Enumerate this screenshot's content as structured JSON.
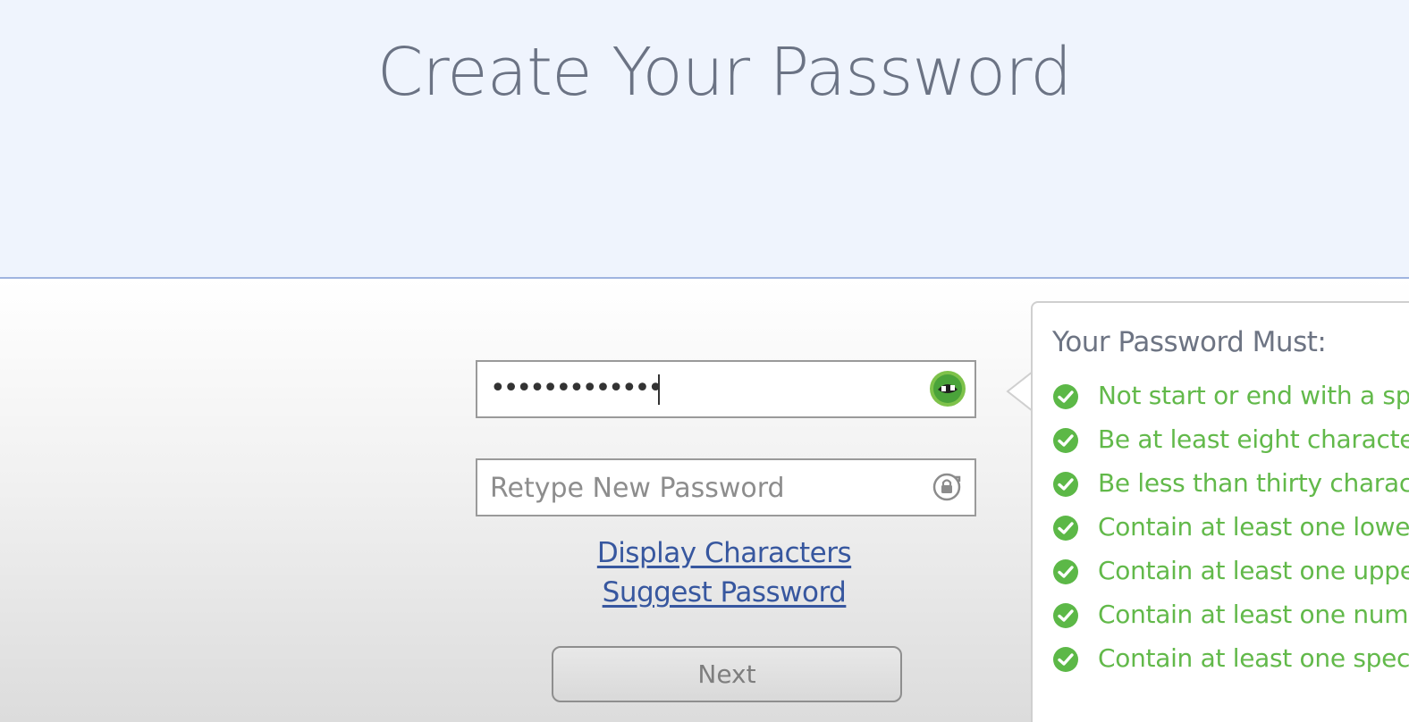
{
  "header": {
    "title": "Create Your Password"
  },
  "form": {
    "password_masked": "•••••••••••••",
    "retype_placeholder": "Retype New Password",
    "display_characters_link": "Display Characters",
    "suggest_password_link": "Suggest Password",
    "next_button": "Next"
  },
  "rules": {
    "title": "Your Password Must:",
    "items": [
      {
        "label": "Not start or end with a space",
        "status": "met"
      },
      {
        "label": "Be at least eight characters long",
        "status": "met"
      },
      {
        "label": "Be less than thirty characters",
        "status": "met"
      },
      {
        "label": "Contain at least one lowercase letter",
        "status": "met"
      },
      {
        "label": "Contain at least one uppercase letter",
        "status": "met"
      },
      {
        "label": "Contain at least one number",
        "status": "met"
      },
      {
        "label": "Contain at least one special character",
        "status": "met"
      }
    ]
  },
  "icons": {
    "password_field_icon": "password-manager-key-icon",
    "retype_field_icon": "lock-refresh-icon",
    "rule_icon": "check-circle-icon"
  },
  "colors": {
    "header_bg": "#eff4fd",
    "title": "#6b7384",
    "link": "#37579f",
    "rule_met": "#62b94a",
    "check_icon": "#5cb847"
  }
}
